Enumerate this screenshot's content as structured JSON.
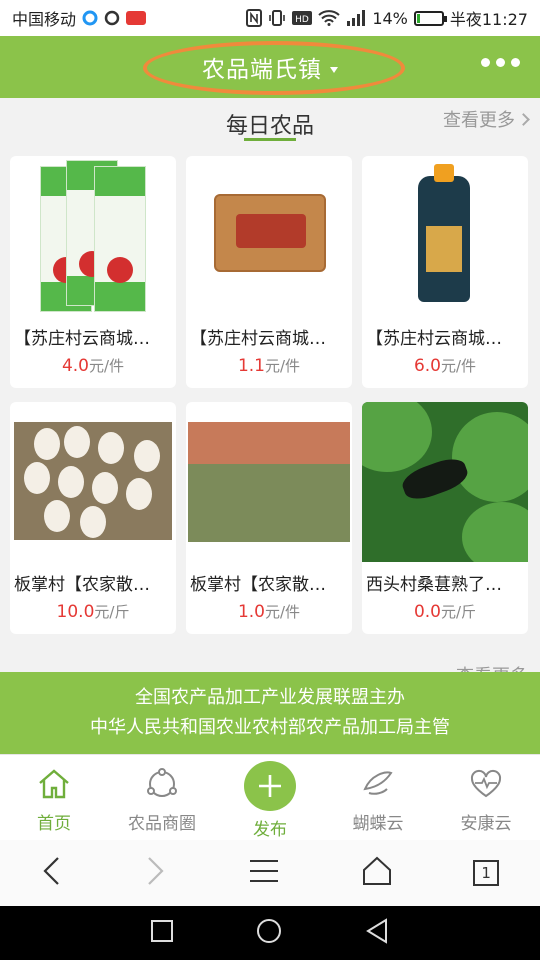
{
  "status_bar": {
    "carrier": "中国移动",
    "battery_percent": "14%",
    "battery_level": 0.14,
    "time": "半夜11:27",
    "signal": "4G"
  },
  "header": {
    "title": "农品端氏镇",
    "menu_icon": "more-dots-icon",
    "accent_color": "#8bc34a",
    "annotation_color": "#f08a3c"
  },
  "section_daily": {
    "title": "每日农品",
    "more_label": "查看更多"
  },
  "products": [
    {
      "name": "【苏庄村云商城…",
      "price": "4.0",
      "unit": "元/件",
      "image": "noodles"
    },
    {
      "name": "【苏庄村云商城…",
      "price": "1.1",
      "unit": "元/件",
      "image": "vinegar-bag"
    },
    {
      "name": "【苏庄村云商城…",
      "price": "6.0",
      "unit": "元/件",
      "image": "vinegar-bottle"
    },
    {
      "name": "板掌村【农家散…",
      "price": "10.0",
      "unit": "元/斤",
      "image": "eggs"
    },
    {
      "name": "板掌村【农家散…",
      "price": "1.0",
      "unit": "元/件",
      "image": "chicken-yard"
    },
    {
      "name": "西头村桑葚熟了…",
      "price": "0.0",
      "unit": "元/斤",
      "image": "mulberry"
    }
  ],
  "section_second": {
    "more_label": "查看更多"
  },
  "banner": {
    "line1": "全国农产品加工产业发展联盟主办",
    "line2": "中华人民共和国农业农村部农产品加工局主管"
  },
  "bottom_nav": [
    {
      "label": "首页",
      "icon": "home-icon",
      "active": true
    },
    {
      "label": "农品商圈",
      "icon": "circle-nodes-icon",
      "active": false
    },
    {
      "label": "发布",
      "icon": "plus-icon",
      "active": true
    },
    {
      "label": "蝴蝶云",
      "icon": "butterfly-icon",
      "active": false
    },
    {
      "label": "安康云",
      "icon": "heart-pulse-icon",
      "active": false
    }
  ],
  "browser_bar": {
    "tab_count": "1"
  }
}
